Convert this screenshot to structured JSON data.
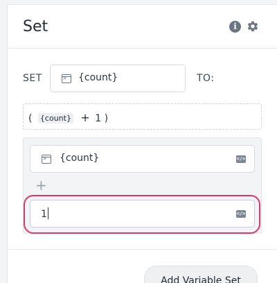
{
  "panel": {
    "title": "Set",
    "info_icon": "info-icon",
    "settings_icon": "gear-icon"
  },
  "set_row": {
    "set_label": "SET",
    "variable": "{count}",
    "to_label": "TO:"
  },
  "expression": {
    "open_paren": "(",
    "variable_chip": "{count}",
    "operator": "+",
    "operand": "1",
    "close_paren": ")"
  },
  "operands": {
    "first_value": "{count}",
    "add_symbol": "+",
    "second_value": "1"
  },
  "footer": {
    "add_button_label": "Add Variable Set"
  },
  "colors": {
    "focus_ring": "#e0366b",
    "card_background": "#f3f4f6"
  }
}
